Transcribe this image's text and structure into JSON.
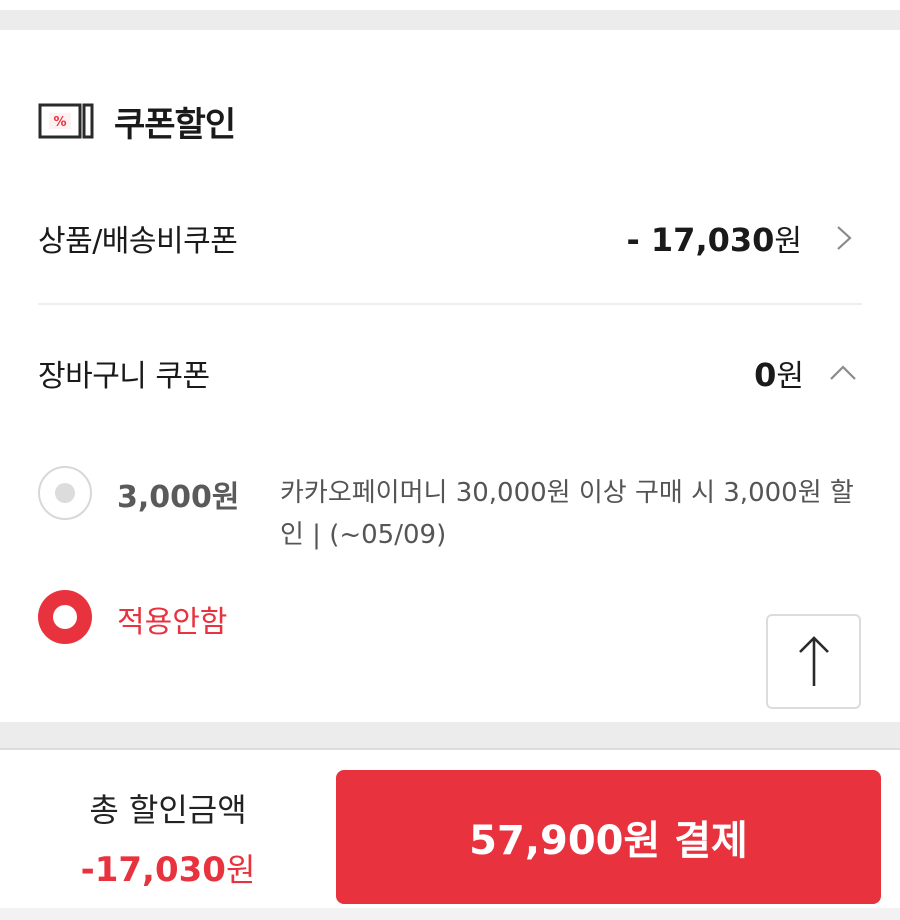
{
  "section": {
    "title": "쿠폰할인",
    "icon": "coupon-icon",
    "icon_symbol": "%"
  },
  "product_coupon": {
    "label": "상품/배송비쿠폰",
    "amount": "- 17,030",
    "unit": "원"
  },
  "cart_coupon": {
    "label": "장바구니 쿠폰",
    "amount": "0",
    "unit": "원",
    "options": [
      {
        "amount": "3,000원",
        "description": "카카오페이머니 30,000원 이상 구매 시 3,000원 할인 | (~05/09)",
        "selected": false
      },
      {
        "label": "적용안함",
        "selected": true
      }
    ]
  },
  "footer": {
    "total_label": "총 할인금액",
    "total_amount": "-17,030",
    "total_unit": "원",
    "pay_button": "57,900원 결제"
  },
  "colors": {
    "accent": "#e8333f",
    "divider": "#eeeeee",
    "band": "#ececec"
  }
}
